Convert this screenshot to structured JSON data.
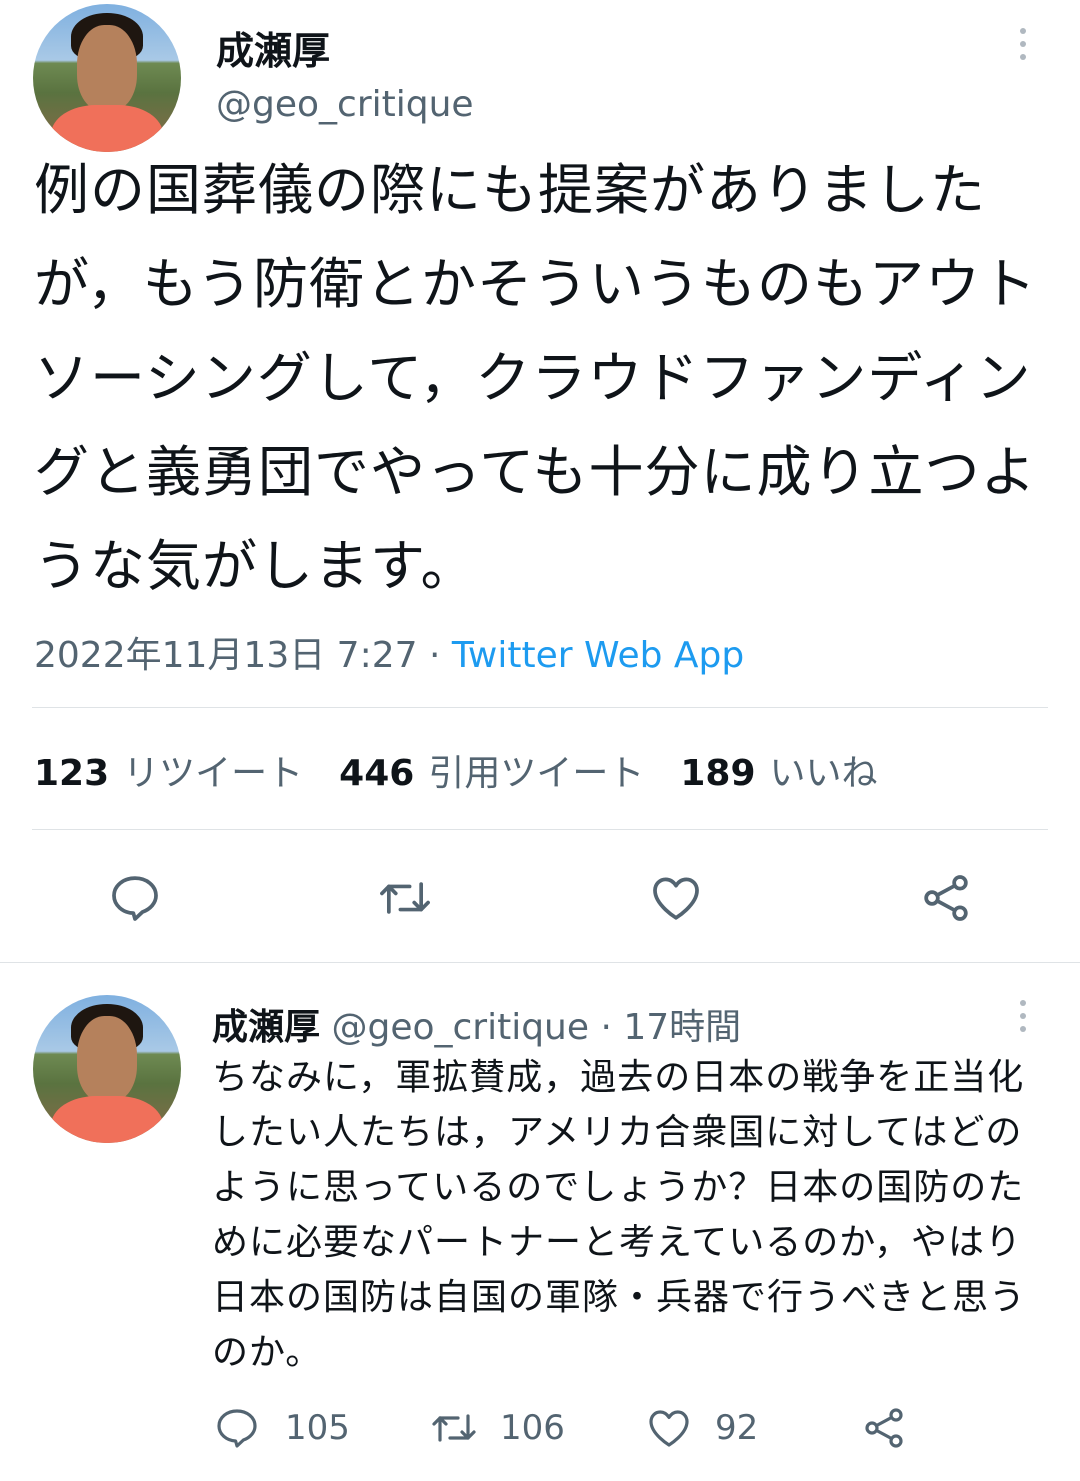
{
  "main_tweet": {
    "author_name": "成瀬厚",
    "author_handle": "@geo_critique",
    "text": "例の国葬儀の際にも提案がありましたが，もう防衛とかそういうものもアウトソーシングして，クラウドファンディングと義勇団でやっても十分に成り立つような気がします。",
    "timestamp": "2022年11月13日 7:27",
    "separator": " · ",
    "source": "Twitter Web App",
    "stats": {
      "retweets_count": "123",
      "retweets_label": "リツイート",
      "quotes_count": "446",
      "quotes_label": "引用ツイート",
      "likes_count": "189",
      "likes_label": "いいね"
    },
    "actions": [
      "reply-icon",
      "retweet-icon",
      "like-icon",
      "share-icon"
    ]
  },
  "reply_tweet": {
    "author_name": "成瀬厚",
    "author_handle": "@geo_critique",
    "time_ago": " · 17時間",
    "text": "ちなみに，軍拡賛成，過去の日本の戦争を正当化したい人たちは，アメリカ合衆国に対してはどのように思っているのでしょうか？日本の国防のために必要なパートナーと考えているのか，やはり日本の国防は自国の軍隊・兵器で行うべきと思うのか。",
    "reply_count": "105",
    "retweet_count": "106",
    "like_count": "92"
  },
  "colors": {
    "text": "#0f1419",
    "secondary": "#536471",
    "link": "#1d9bf0",
    "divider": "#dfe3e6"
  }
}
